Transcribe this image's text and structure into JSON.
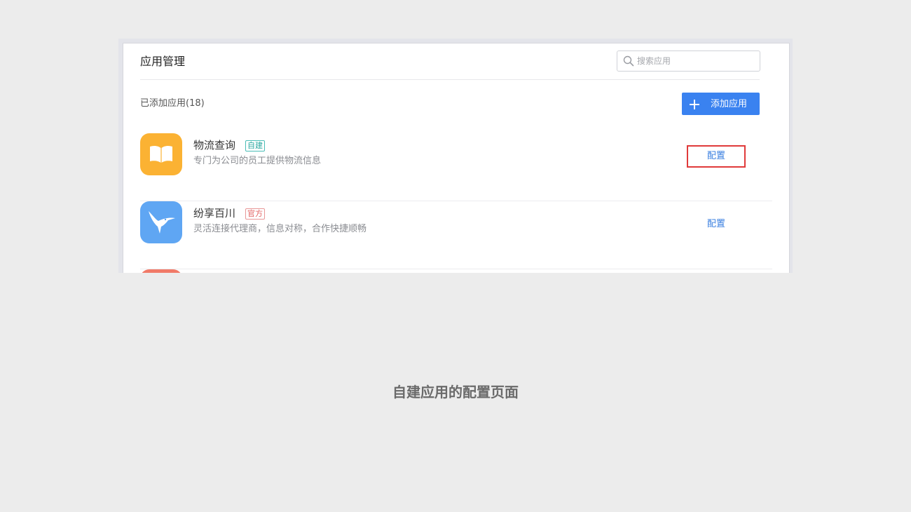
{
  "header": {
    "title": "应用管理",
    "search_placeholder": "搜索应用"
  },
  "toolbar": {
    "added_count_label": "已添加应用(18)",
    "add_button_label": "添加应用"
  },
  "apps": [
    {
      "name": "物流查询",
      "tag": "自建",
      "description": "专门为公司的员工提供物流信息",
      "action_label": "配置",
      "icon": "book-icon",
      "icon_color": "#fbb233"
    },
    {
      "name": "纷享百川",
      "tag": "官方",
      "description": "灵活连接代理商，信息对称，合作快捷顺畅",
      "action_label": "配置",
      "icon": "hummingbird-icon",
      "icon_color": "#5fa6f3"
    },
    {
      "icon": "app-icon",
      "icon_color": "#f17a68"
    }
  ],
  "caption": "自建应用的配置页面",
  "colors": {
    "primary": "#3a82f0",
    "highlight_border": "#e03a3a",
    "background": "#ececec"
  }
}
